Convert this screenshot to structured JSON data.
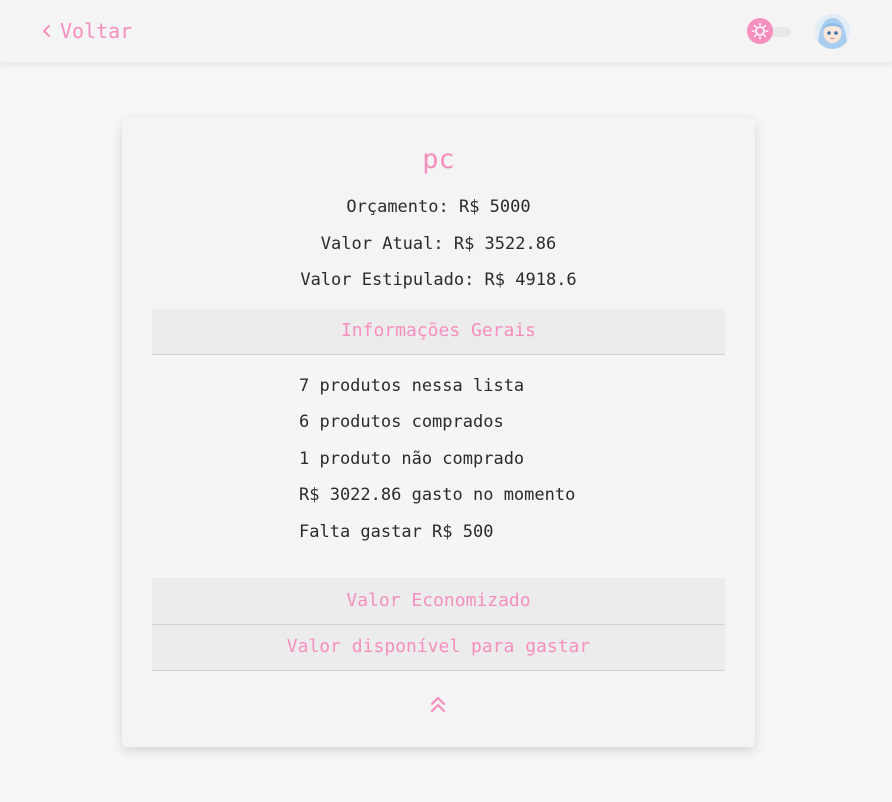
{
  "header": {
    "back_label": "Voltar",
    "theme_toggle_icon": "sun-icon",
    "avatar_icon": "user-avatar"
  },
  "colors": {
    "accent": "#f58fbf",
    "page_bg": "#f7f7f7",
    "card_bg": "#f4f4f4",
    "accordion_header_bg": "#ececec",
    "text": "#2b2b2b"
  },
  "list": {
    "name": "pc",
    "budget": "Orçamento: R$ 5000",
    "current_value": "Valor Atual: R$ 3522.86",
    "estimated_value": "Valor Estipulado: R$ 4918.6"
  },
  "accordion": {
    "sections": [
      {
        "title": "Informações Gerais",
        "expanded": true,
        "lines": [
          "7 produtos nessa lista",
          "6 produtos comprados",
          "1 produto não comprado",
          "R$ 3022.86 gasto no momento",
          "Falta gastar R$ 500"
        ]
      },
      {
        "title": "Valor Economizado",
        "expanded": false
      },
      {
        "title": "Valor disponível para gastar",
        "expanded": false
      }
    ]
  },
  "footer": {
    "collapse_icon": "double-chevron-up-icon"
  }
}
